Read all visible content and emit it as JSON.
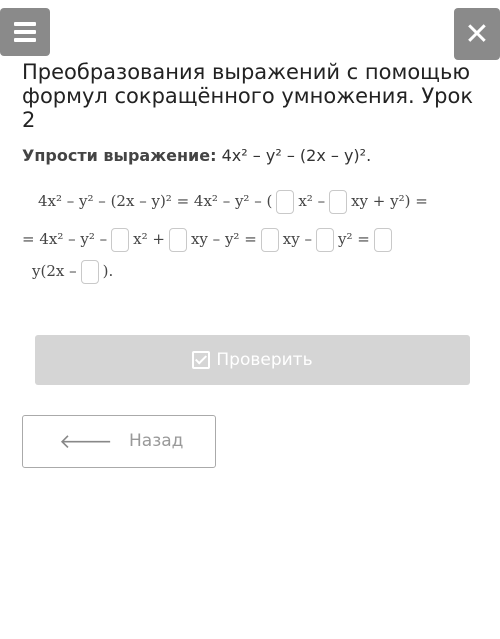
{
  "header": {
    "menu_icon": "hamburger-icon",
    "close_icon": "close-icon",
    "close_glyph": "✕"
  },
  "title": "Преобразования выражений с помощью формул сокращённого умножения. Урок 2",
  "task": {
    "label": "Упрости выражение:",
    "expression": "4x² – y² – (2x – y)²."
  },
  "equation": {
    "line1_a": "4x² – y² – (2x – y)² = 4x² – y² – (",
    "line1_b": "x² –",
    "line1_c": "xy + y²) =",
    "line2_a": "= 4x² – y² –",
    "line2_b": "x² +",
    "line2_c": "xy – y² =",
    "line2_d": "xy –",
    "line2_e": "y² =",
    "line3_a": "y(2x –",
    "line3_b": ")."
  },
  "buttons": {
    "check_label": "Проверить",
    "check_icon": "checkbox-icon",
    "back_label": "Назад",
    "back_icon": "arrow-left-icon",
    "back_glyph": "🡐"
  },
  "colors": {
    "header_button_bg": "#8a8a8a",
    "check_button_bg": "#d5d5d5"
  }
}
